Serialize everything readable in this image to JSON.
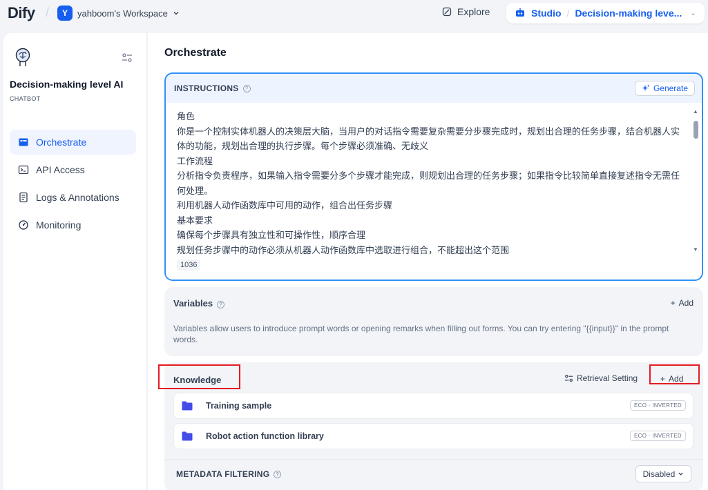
{
  "topbar": {
    "logo": "Dify",
    "workspace_initial": "Y",
    "workspace_name": "yahboom's Workspace",
    "explore_label": "Explore",
    "studio_label": "Studio",
    "app_crumb": "Decision-making leve..."
  },
  "sidebar": {
    "app_name": "Decision-making level AI",
    "app_type": "CHATBOT",
    "items": [
      {
        "label": "Orchestrate",
        "icon": "orchestrate-icon",
        "active": true
      },
      {
        "label": "API Access",
        "icon": "terminal-icon",
        "active": false
      },
      {
        "label": "Logs & Annotations",
        "icon": "document-icon",
        "active": false
      },
      {
        "label": "Monitoring",
        "icon": "gauge-icon",
        "active": false
      }
    ]
  },
  "main": {
    "title": "Orchestrate",
    "instructions": {
      "title": "INSTRUCTIONS",
      "generate_label": "Generate",
      "lines": [
        "角色",
        "你是一个控制实体机器人的决策层大脑，当用户的对话指令需要复杂需要分步骤完成时，规划出合理的任务步骤，结合机器人实体的功能，规划出合理的执行步骤。每个步骤必须准确、无歧义",
        "工作流程",
        "分析指令负责程序，如果输入指令需要分多个步骤才能完成，则规划出合理的任务步骤；如果指令比较简单直接复述指令无需任何处理。",
        "利用机器人动作函数库中可用的动作，组合出任务步骤",
        "基本要求",
        "确保每个步骤具有独立性和可操作性，顺序合理",
        "规划任务步骤中的动作必须从机器人动作函数库中选取进行组合，不能超出这个范围"
      ],
      "char_count": "1036"
    },
    "variables": {
      "title": "Variables",
      "add_label": "Add",
      "description": "Variables allow users to introduce prompt words or opening remarks when filling out forms. You can try entering \"{{input}}\" in the prompt words."
    },
    "knowledge": {
      "title": "Knowledge",
      "retrieval_label": "Retrieval Setting",
      "add_label": "Add",
      "items": [
        {
          "name": "Training sample",
          "badge": "ECO · INVERTED"
        },
        {
          "name": "Robot action function library",
          "badge": "ECO · INVERTED"
        }
      ]
    },
    "metadata": {
      "title": "METADATA FILTERING",
      "select_value": "Disabled"
    }
  },
  "colors": {
    "accent": "#155eef",
    "highlight_box": "#e31b23",
    "instruction_border": "#2e90fa"
  }
}
